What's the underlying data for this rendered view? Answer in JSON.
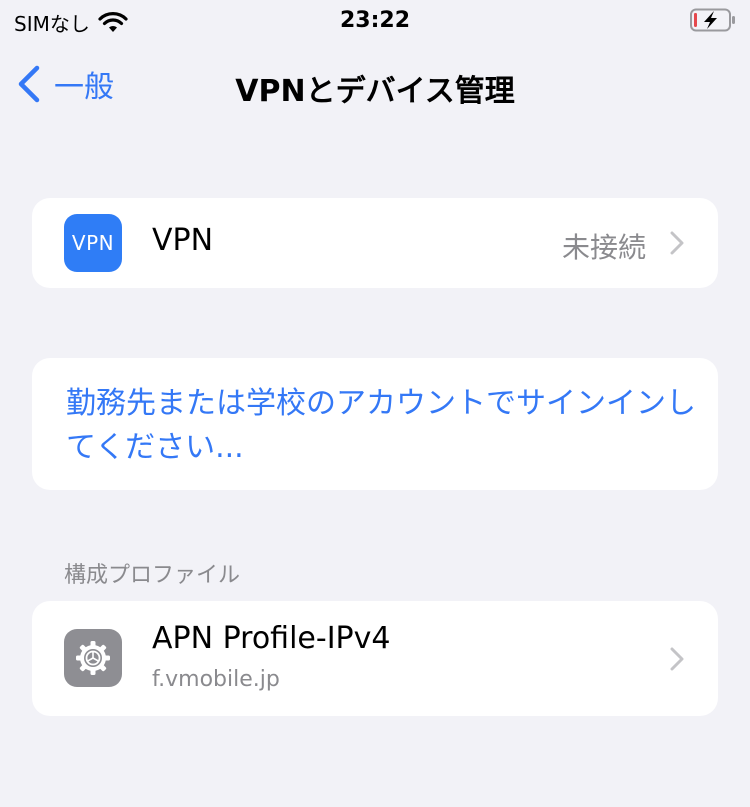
{
  "status_bar": {
    "carrier": "SIMなし",
    "time": "23:22",
    "icons": [
      "wifi-icon",
      "battery-charging-icon"
    ]
  },
  "nav": {
    "back_label": "一般",
    "title": "VPNとデバイス管理"
  },
  "vpn_row": {
    "icon_text": "VPN",
    "label": "VPN",
    "value": "未接続"
  },
  "signin": {
    "text": "勤務先または学校のアカウントでサインインしてください..."
  },
  "profiles": {
    "header": "構成プロファイル",
    "items": [
      {
        "name": "APN Profile-IPv4",
        "subtitle": "f.vmobile.jp",
        "icon": "gear-icon"
      }
    ]
  },
  "colors": {
    "accent": "#3478f6",
    "background": "#f2f2f7",
    "secondary_text": "#8a8a8e",
    "vpn_icon": "#2f7df6",
    "settings_icon": "#8e8e93",
    "battery_low": "#e5484d"
  }
}
